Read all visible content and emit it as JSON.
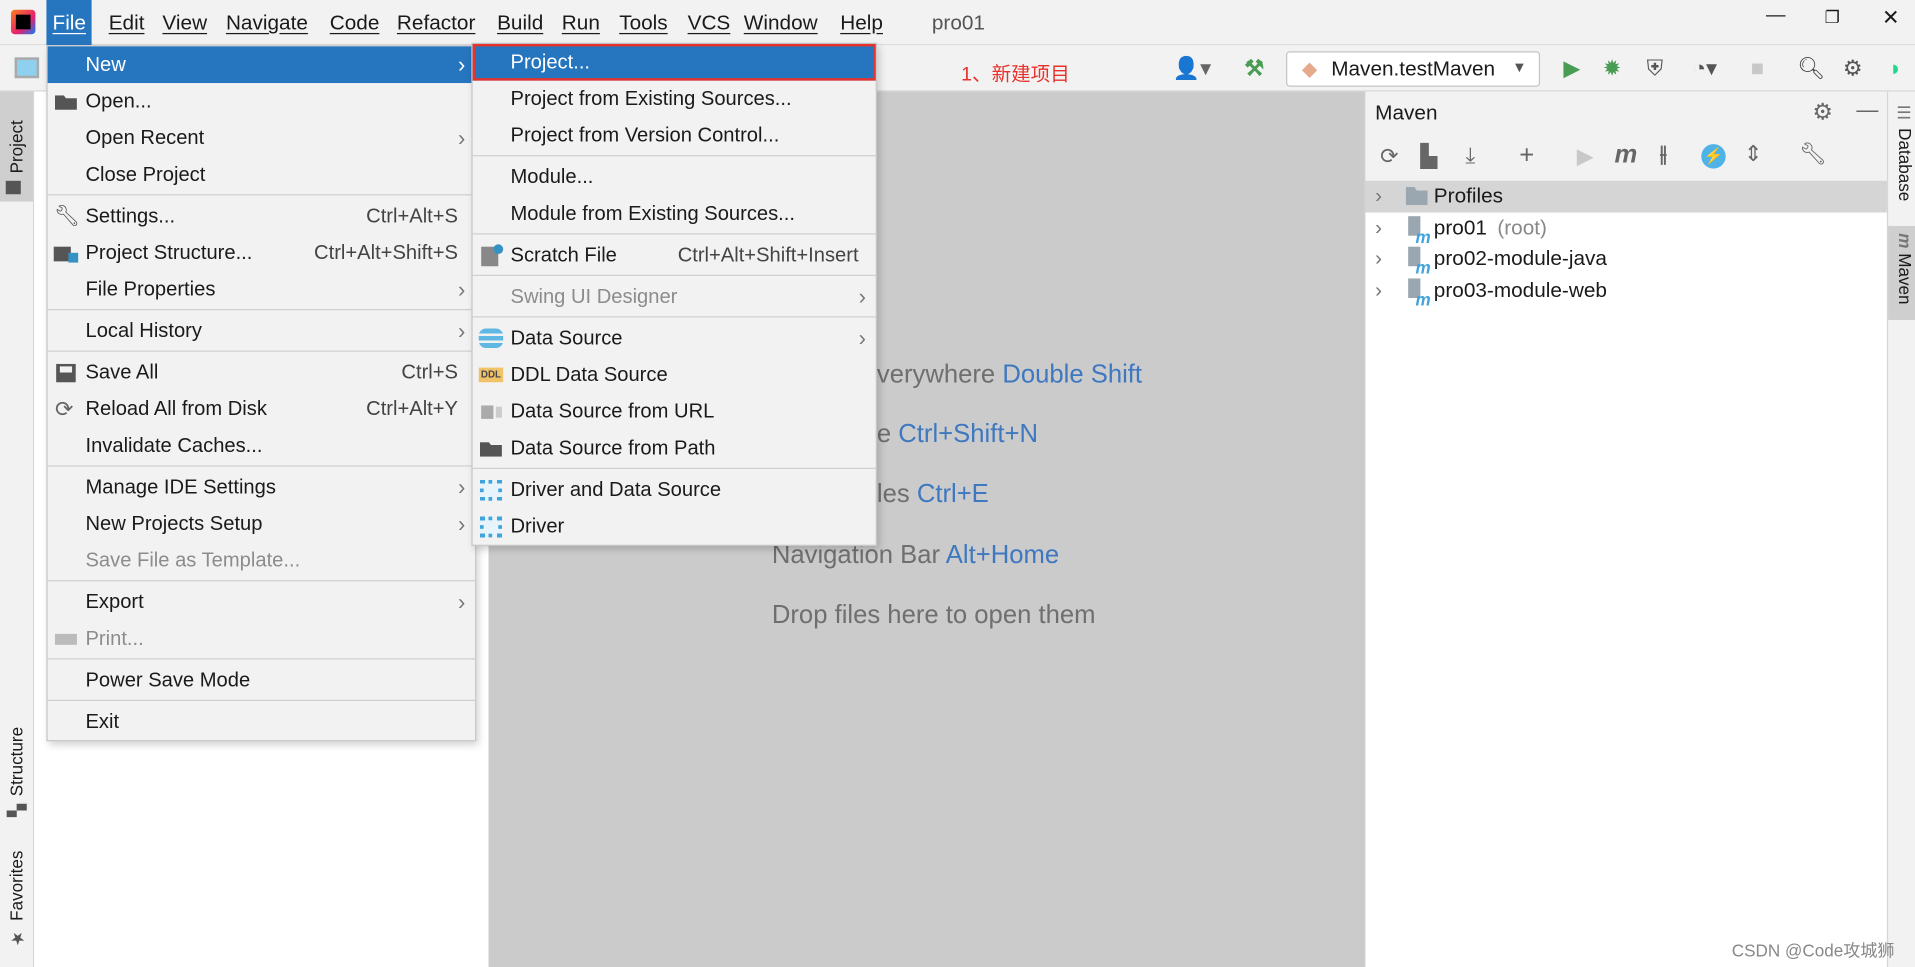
{
  "menubar": {
    "items": [
      "File",
      "Edit",
      "View",
      "Navigate",
      "Code",
      "Refactor",
      "Build",
      "Run",
      "Tools",
      "VCS",
      "Window",
      "Help"
    ],
    "project_name": "pro01"
  },
  "toolbar": {
    "annotation": "1、新建项目",
    "run_config": "Maven.testMaven"
  },
  "left_tabs": {
    "project": "Project",
    "structure": "Structure",
    "favorites": "Favorites"
  },
  "right_tabs": {
    "database": "Database",
    "maven": "Maven"
  },
  "file_menu": [
    {
      "label": "New",
      "arrow": true,
      "selected": true
    },
    {
      "label": "Open...",
      "icon": "folder-open-icon"
    },
    {
      "label": "Open Recent",
      "arrow": true
    },
    {
      "label": "Close Project",
      "sep_after": true
    },
    {
      "label": "Settings...",
      "shortcut": "Ctrl+Alt+S",
      "icon": "wrench-icon"
    },
    {
      "label": "Project Structure...",
      "shortcut": "Ctrl+Alt+Shift+S",
      "icon": "project-structure-icon"
    },
    {
      "label": "File Properties",
      "arrow": true,
      "sep_after": true
    },
    {
      "label": "Local History",
      "arrow": true,
      "sep_after": true
    },
    {
      "label": "Save All",
      "shortcut": "Ctrl+S",
      "icon": "save-icon"
    },
    {
      "label": "Reload All from Disk",
      "shortcut": "Ctrl+Alt+Y",
      "icon": "reload-icon"
    },
    {
      "label": "Invalidate Caches...",
      "sep_after": true
    },
    {
      "label": "Manage IDE Settings",
      "arrow": true
    },
    {
      "label": "New Projects Setup",
      "arrow": true
    },
    {
      "label": "Save File as Template...",
      "disabled": true,
      "sep_after": true
    },
    {
      "label": "Export",
      "arrow": true
    },
    {
      "label": "Print...",
      "disabled": true,
      "icon": "print-icon",
      "sep_after": true
    },
    {
      "label": "Power Save Mode",
      "sep_after": true
    },
    {
      "label": "Exit"
    }
  ],
  "new_submenu": [
    {
      "label": "Project...",
      "selected": true
    },
    {
      "label": "Project from Existing Sources..."
    },
    {
      "label": "Project from Version Control...",
      "sep_after": true
    },
    {
      "label": "Module..."
    },
    {
      "label": "Module from Existing Sources...",
      "sep_after": true
    },
    {
      "label": "Scratch File",
      "shortcut": "Ctrl+Alt+Shift+Insert",
      "icon": "scratch-file-icon",
      "sep_after": true
    },
    {
      "label": "Swing UI Designer",
      "arrow": true,
      "disabled": true,
      "sep_after": true
    },
    {
      "label": "Data Source",
      "arrow": true,
      "icon": "database-icon"
    },
    {
      "label": "DDL Data Source",
      "icon": "ddl-icon"
    },
    {
      "label": "Data Source from URL",
      "icon": "url-plug-icon"
    },
    {
      "label": "Data Source from Path",
      "icon": "folder-open-icon",
      "sep_after": true
    },
    {
      "label": "Driver and Data Source",
      "icon": "driver-icon"
    },
    {
      "label": "Driver",
      "icon": "driver-icon"
    }
  ],
  "editor_hints": [
    {
      "text": "verywhere ",
      "key": "Double Shift"
    },
    {
      "text": "e ",
      "key": "Ctrl+Shift+N"
    },
    {
      "text": "les ",
      "key": "Ctrl+E"
    },
    {
      "text": "Navigation Bar ",
      "key": "Alt+Home"
    },
    {
      "text": "Drop files here to open them",
      "key": ""
    }
  ],
  "maven": {
    "title": "Maven",
    "tree": [
      {
        "label": "Profiles",
        "suffix": ""
      },
      {
        "label": "pro01",
        "suffix": "(root)"
      },
      {
        "label": "pro02-module-java",
        "suffix": ""
      },
      {
        "label": "pro03-module-web",
        "suffix": ""
      }
    ]
  },
  "watermark": "CSDN @Code攻城狮",
  "colors": {
    "accent": "#2675bf",
    "annotation": "#e8322c",
    "run_green": "#499c54"
  }
}
